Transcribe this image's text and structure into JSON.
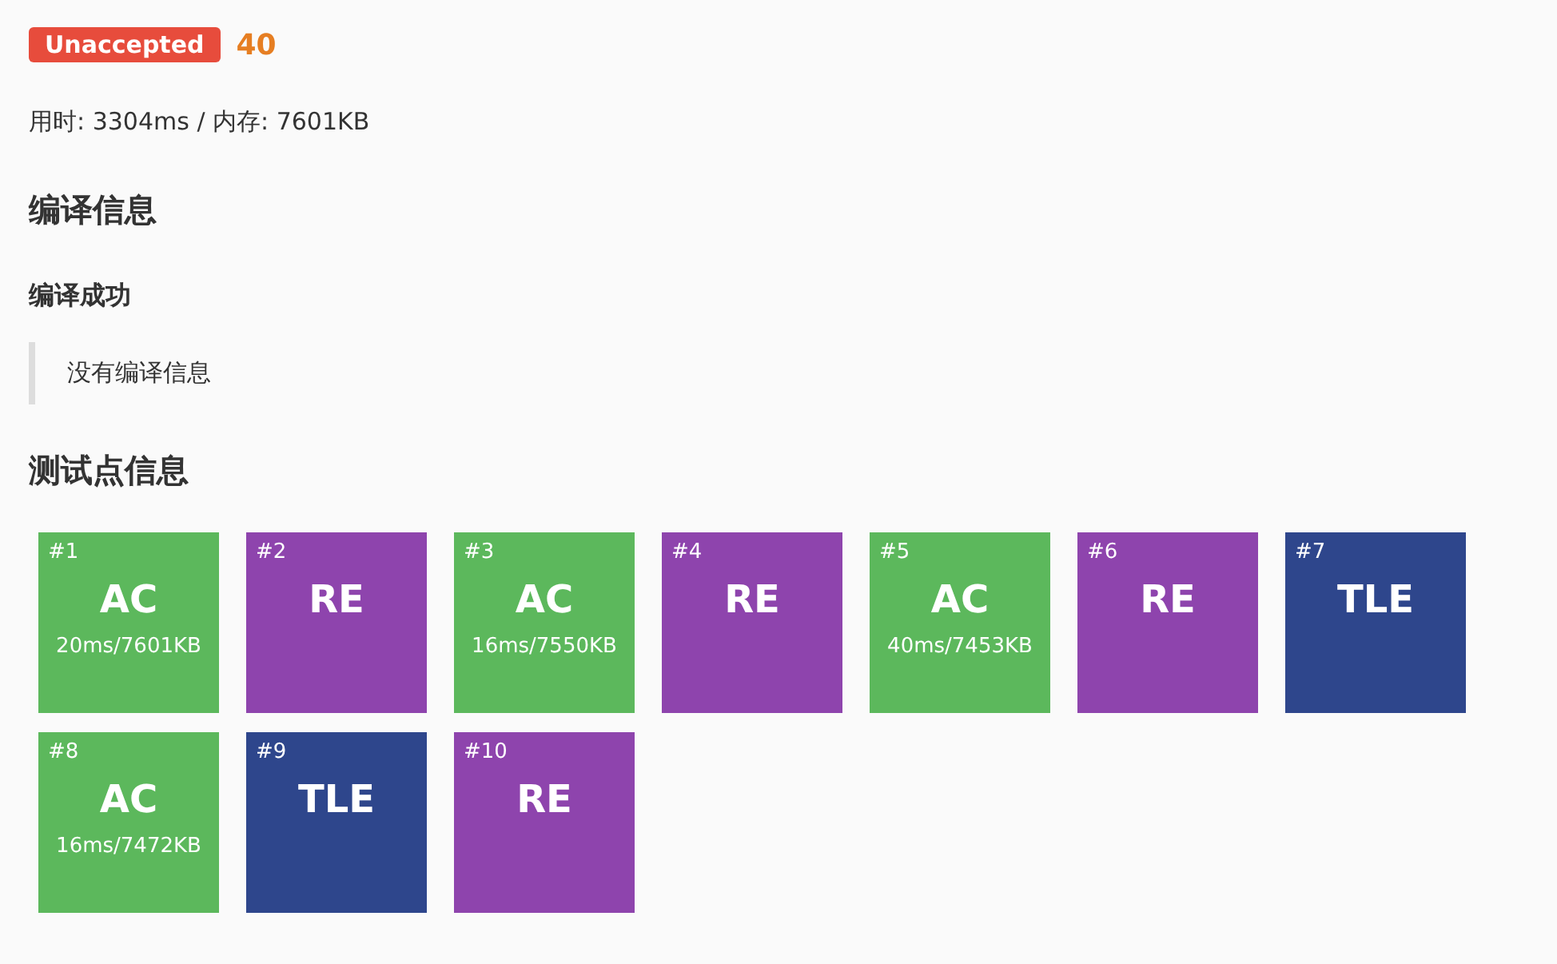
{
  "verdict": {
    "label": "Unaccepted",
    "score": "40"
  },
  "stats": "用时: 3304ms / 内存: 7601KB",
  "compile": {
    "heading": "编译信息",
    "status": "编译成功",
    "message": "没有编译信息"
  },
  "tests": {
    "heading": "测试点信息",
    "items": [
      {
        "id": "#1",
        "result": "AC",
        "detail": "20ms/7601KB",
        "color": "#5cb85c"
      },
      {
        "id": "#2",
        "result": "RE",
        "color": "#8e44ad"
      },
      {
        "id": "#3",
        "result": "AC",
        "detail": "16ms/7550KB",
        "color": "#5cb85c"
      },
      {
        "id": "#4",
        "result": "RE",
        "color": "#8e44ad"
      },
      {
        "id": "#5",
        "result": "AC",
        "detail": "40ms/7453KB",
        "color": "#5cb85c"
      },
      {
        "id": "#6",
        "result": "RE",
        "color": "#8e44ad"
      },
      {
        "id": "#7",
        "result": "TLE",
        "color": "#2e468c"
      },
      {
        "id": "#8",
        "result": "AC",
        "detail": "16ms/7472KB",
        "color": "#5cb85c"
      },
      {
        "id": "#9",
        "result": "TLE",
        "color": "#2e468c"
      },
      {
        "id": "#10",
        "result": "RE",
        "color": "#8e44ad"
      }
    ]
  }
}
